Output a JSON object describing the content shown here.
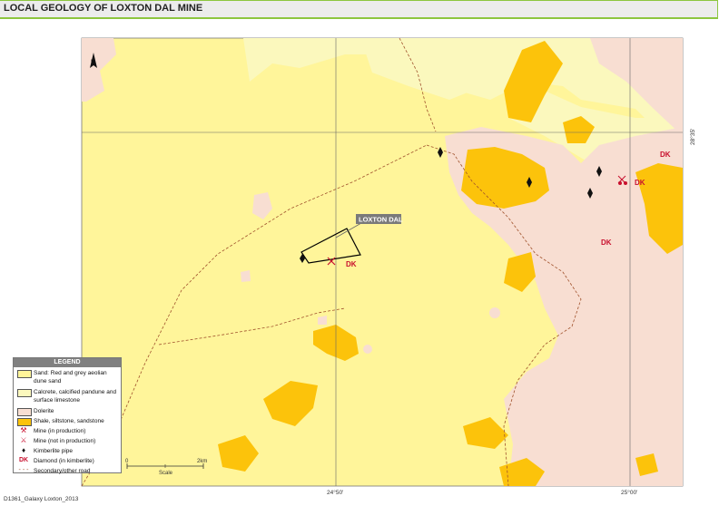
{
  "title": "LOCAL GEOLOGY OF LOXTON DAL MINE",
  "footer": "D1361_Galaxy Loxton_2013",
  "coordinates": {
    "lat_right": "28°35'",
    "lon_left": "24°50'",
    "lon_right": "25°00'"
  },
  "callout_label": "LOXTON DAL",
  "north_label": "N",
  "dk_label": "DK",
  "scale": {
    "start": "0",
    "label": "Scale",
    "end": "2km"
  },
  "legend": {
    "title": "LEGEND",
    "items": [
      {
        "type": "swatch",
        "color": "#fff59a",
        "label": "Sand: Red and grey aeolian dune sand"
      },
      {
        "type": "swatch",
        "color": "#fbf8bd",
        "label": "Calcrete, calcified pandune and surface limestone"
      },
      {
        "type": "swatch",
        "color": "#f8ded2",
        "label": "Dolerite"
      },
      {
        "type": "swatch",
        "color": "#fcc30b",
        "label": "Shale, siltstone, sandstone"
      },
      {
        "type": "symbol",
        "symbol": "⚒",
        "label": "Mine (in production)"
      },
      {
        "type": "symbol",
        "symbol": "⚔",
        "label": "Mine (not in production)"
      },
      {
        "type": "symbol",
        "symbol": "♦",
        "label": "Kimberlite pipe"
      },
      {
        "type": "symbol",
        "symbol": "DK",
        "label": "Diamond (in kimberlite)"
      },
      {
        "type": "line",
        "symbol": "- - -",
        "label": "Secondary/other road"
      }
    ]
  },
  "colors": {
    "sand": "#fff59a",
    "calcrete": "#fbf8bd",
    "dolerite": "#f8ded2",
    "shale": "#fcc30b",
    "accent": "#8dc63f",
    "diamond_red": "#c8102e"
  }
}
